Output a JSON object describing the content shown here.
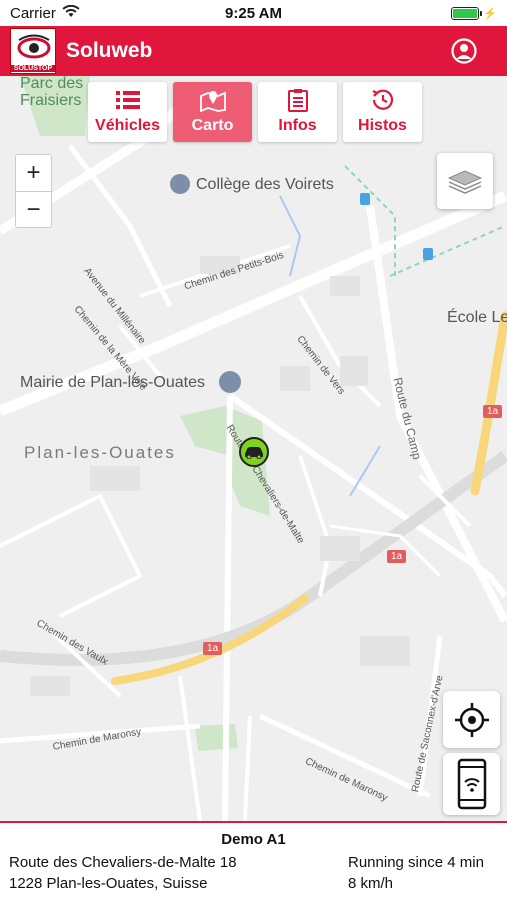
{
  "status": {
    "carrier": "Carrier",
    "time": "9:25 AM",
    "battery_level": 1.0
  },
  "header": {
    "title": "Soluweb",
    "logo_text": "SOLUSTOP"
  },
  "tabs": [
    {
      "label": "Véhicles",
      "icon": "list-icon",
      "active": false
    },
    {
      "label": "Carto",
      "icon": "map-icon",
      "active": true
    },
    {
      "label": "Infos",
      "icon": "clipboard-icon",
      "active": false
    },
    {
      "label": "Histos",
      "icon": "history-icon",
      "active": false
    }
  ],
  "zoom": {
    "in": "+",
    "out": "−"
  },
  "map_labels": {
    "park": "Parc des Fraisiers",
    "college": "Collège des Voirets",
    "ecole": "École Le",
    "mairie": "Mairie de Plan-les-Ouates",
    "town": "Plan-les-Ouates",
    "millenaire": "Avenue du Millénaire",
    "petits_bois": "Chemin des Petits-Bois",
    "mere_voie": "Chemin de la Mère Voie",
    "vers": "Chemin de Vers",
    "camp": "Route du Camp",
    "chevaliers": "Route des Chevaliers-de-Malte",
    "vaulx": "Chemin des Vaulx",
    "maronsy": "Chemin de Maronsy",
    "maronsy2": "Chemin de Maronsy",
    "saconnex": "Route de Saconnex-d'Arve",
    "badge_1a": "1a"
  },
  "vehicle": {
    "name": "Demo A1",
    "address_line1": "Route des Chevaliers-de-Malte 18",
    "address_line2": "1228 Plan-les-Ouates, Suisse",
    "status": "Running since 4 min",
    "speed": "8 km/h"
  },
  "colors": {
    "brand": "#e0163c",
    "active_tab": "#ee5d73",
    "vehicle_marker": "#7ed321"
  }
}
